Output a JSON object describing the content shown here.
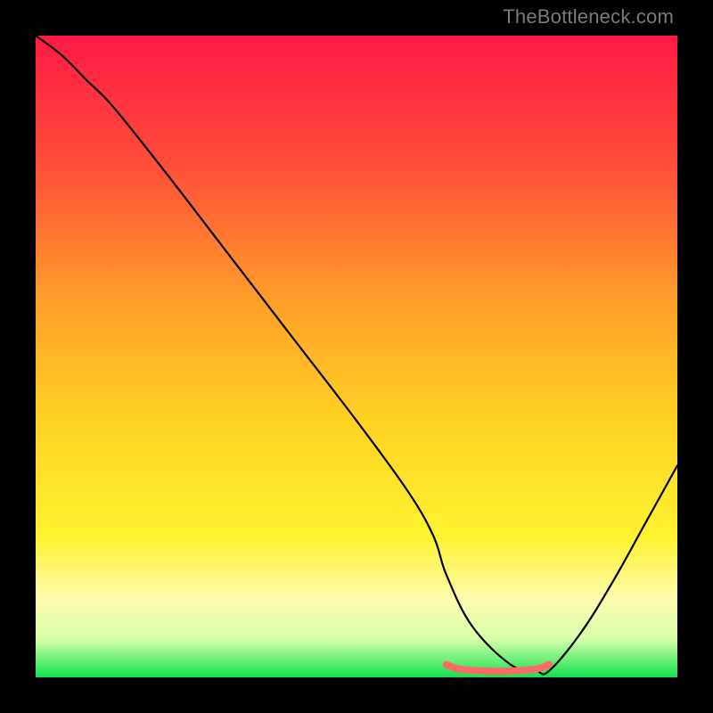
{
  "watermark": "TheBottleneck.com",
  "chart_data": {
    "type": "line",
    "title": "",
    "xlabel": "",
    "ylabel": "",
    "xlim": [
      0,
      100
    ],
    "ylim": [
      0,
      100
    ],
    "background_gradient": {
      "stops": [
        {
          "offset": 0.0,
          "color": "#ff1a44"
        },
        {
          "offset": 0.2,
          "color": "#ff4d3a"
        },
        {
          "offset": 0.4,
          "color": "#ff9a2a"
        },
        {
          "offset": 0.6,
          "color": "#ffd224"
        },
        {
          "offset": 0.78,
          "color": "#fff230"
        },
        {
          "offset": 0.88,
          "color": "#fdfcb0"
        },
        {
          "offset": 0.94,
          "color": "#d8ffab"
        },
        {
          "offset": 1.0,
          "color": "#14e24e"
        }
      ]
    },
    "series": [
      {
        "name": "bottleneck-curve",
        "color": "#000000",
        "width": 2.2,
        "x": [
          0,
          4,
          8,
          12,
          20,
          30,
          40,
          50,
          58,
          62,
          64,
          68,
          74,
          78,
          80,
          85,
          90,
          95,
          100
        ],
        "y": [
          100,
          97,
          93,
          89,
          79,
          66,
          53,
          40,
          29,
          22,
          16,
          8,
          2,
          1,
          1,
          7,
          15,
          24,
          33
        ]
      },
      {
        "name": "highlight-segment",
        "color": "#ff6a66",
        "width": 8,
        "x": [
          64,
          66,
          70,
          74,
          78,
          80
        ],
        "y": [
          2,
          1.3,
          1,
          1,
          1.3,
          2
        ]
      }
    ]
  }
}
